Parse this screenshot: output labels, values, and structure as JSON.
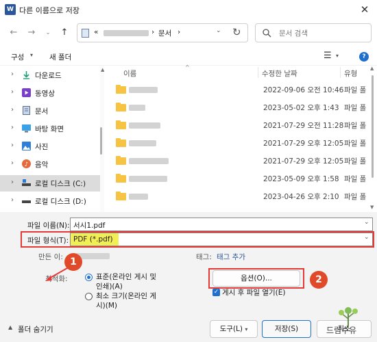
{
  "window": {
    "title": "다른 이름으로 저장",
    "app_icon_letter": "W"
  },
  "address": {
    "prefix": "«",
    "current_folder": "문서",
    "separator": "›"
  },
  "search": {
    "placeholder": "문서 검색"
  },
  "command_bar": {
    "organize": "구성",
    "new_folder": "새 폴더"
  },
  "nav_items": [
    {
      "label": "다운로드",
      "icon": "download-icon"
    },
    {
      "label": "동영상",
      "icon": "video-icon"
    },
    {
      "label": "문서",
      "icon": "document-icon"
    },
    {
      "label": "바탕 화면",
      "icon": "desktop-icon"
    },
    {
      "label": "사진",
      "icon": "picture-icon"
    },
    {
      "label": "음악",
      "icon": "music-icon"
    },
    {
      "label": "로컬 디스크 (C:)",
      "icon": "drive-icon"
    },
    {
      "label": "로컬 디스크 (D:)",
      "icon": "drive-icon"
    }
  ],
  "columns": {
    "name": "이름",
    "modified": "수정한 날짜",
    "type": "유형"
  },
  "files": [
    {
      "date": "2022-09-06 오전 10:46",
      "type": "파일 폴"
    },
    {
      "date": "2023-05-02 오후 1:43",
      "type": "파일 폴"
    },
    {
      "date": "2021-07-29 오전 11:28",
      "type": "파일 폴"
    },
    {
      "date": "2021-07-29 오후 12:05",
      "type": "파일 폴"
    },
    {
      "date": "2021-07-29 오후 12:05",
      "type": "파일 폴"
    },
    {
      "date": "2023-05-09 오후 1:58",
      "type": "파일 폴"
    },
    {
      "date": "2023-04-26 오후 2:10",
      "type": "파일 폴"
    }
  ],
  "form": {
    "filename_label": "파일 이름(N):",
    "filename_value": "서시1.pdf",
    "filetype_label": "파일 형식(T):",
    "filetype_value": "PDF (*.pdf)",
    "author_label": "만든 이:",
    "tags_label": "태그:",
    "tags_value": "태그 추가",
    "optimize_label": "최적화:",
    "opt_standard": "표준(온라인 게시 및 인쇄)(A)",
    "opt_standard_l1": "표준(온라인 게시 및",
    "opt_standard_l2": "인쇄)(A)",
    "opt_min_l1": "최소 크기(온라인 게",
    "opt_min_l2": "시)(M)",
    "options_button": "옵션(O)...",
    "open_after": "게시 후 파일 열기(E)"
  },
  "footer": {
    "hide_folders": "폴더 숨기기",
    "tools": "도구(L)",
    "save": "저장(S)",
    "cancel": "취소"
  },
  "callouts": [
    "1",
    "2"
  ],
  "watermark": "드림수유"
}
